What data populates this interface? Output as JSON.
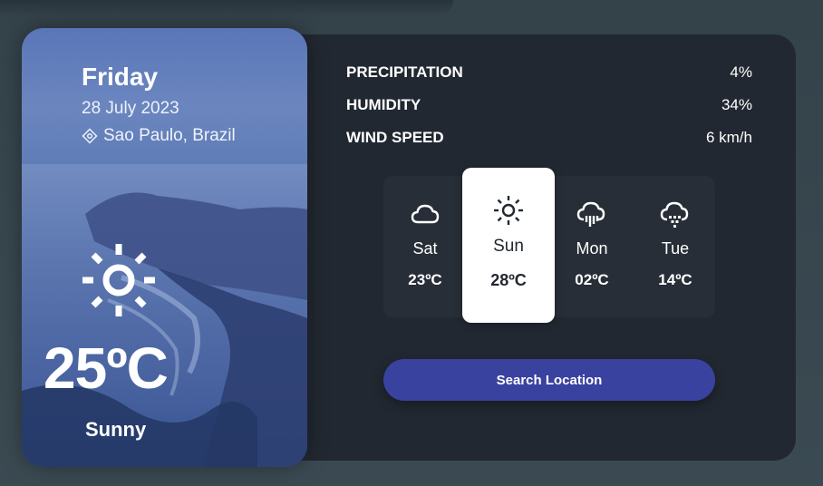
{
  "current": {
    "day": "Friday",
    "date": "28 July 2023",
    "location": "Sao Paulo, Brazil",
    "temperature": "25ºC",
    "condition": "Sunny",
    "icon": "sun-icon"
  },
  "stats": [
    {
      "label": "PRECIPITATION",
      "value": "4%"
    },
    {
      "label": "HUMIDITY",
      "value": "34%"
    },
    {
      "label": "WIND SPEED",
      "value": "6 km/h"
    }
  ],
  "forecast": [
    {
      "day": "Sat",
      "temp": "23ºC",
      "icon": "cloud-icon",
      "active": false
    },
    {
      "day": "Sun",
      "temp": "28ºC",
      "icon": "sun-icon",
      "active": true
    },
    {
      "day": "Mon",
      "temp": "02ºC",
      "icon": "cloud-rain-icon",
      "active": false
    },
    {
      "day": "Tue",
      "temp": "14ºC",
      "icon": "cloud-snow-icon",
      "active": false
    }
  ],
  "search": {
    "label": "Search Location"
  },
  "colors": {
    "background": "#3b4a52",
    "card": "#222831",
    "accent": "#3a42a0",
    "active_tile": "#ffffff"
  }
}
